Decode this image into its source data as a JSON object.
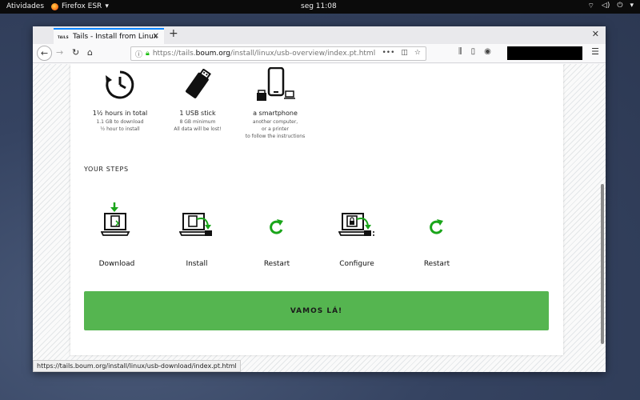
{
  "system": {
    "activities": "Atividades",
    "app_name": "Firefox ESR",
    "clock": "seg 11:08"
  },
  "browser": {
    "tab_favicon_text": "TAILS",
    "tab_title": "Tails - Install from Linux",
    "url_prefix": "https://tails.",
    "url_domain": "boum.org",
    "url_path": "/install/linux/usb-overview/index.pt.html",
    "status_url": "https://tails.boum.org/install/linux/usb-download/index.pt.html"
  },
  "requirements": [
    {
      "icon": "clock-icon",
      "title": "1½ hours in total",
      "lines": [
        "1.1 GB to download",
        "½ hour to install"
      ]
    },
    {
      "icon": "usb-stick-icon",
      "title": "1 USB stick",
      "lines": [
        "8 GB minimum",
        "All data will be lost!"
      ]
    },
    {
      "icon": "smartphone-icon",
      "title": "a smartphone",
      "lines": [
        "another computer,",
        "or a printer",
        "to follow the instructions"
      ]
    }
  ],
  "steps_heading": "YOUR STEPS",
  "steps": [
    {
      "icon": "download-laptop-icon",
      "label": "Download"
    },
    {
      "icon": "install-laptop-icon",
      "label": "Install"
    },
    {
      "icon": "restart-icon",
      "label": "Restart"
    },
    {
      "icon": "configure-laptop-icon",
      "label": "Configure"
    },
    {
      "icon": "restart-icon",
      "label": "Restart"
    }
  ],
  "cta_label": "VAMOS LÁ!",
  "colors": {
    "accent_green": "#55b550",
    "icon_green": "#1aa51a",
    "tab_highlight": "#0a84ff"
  }
}
